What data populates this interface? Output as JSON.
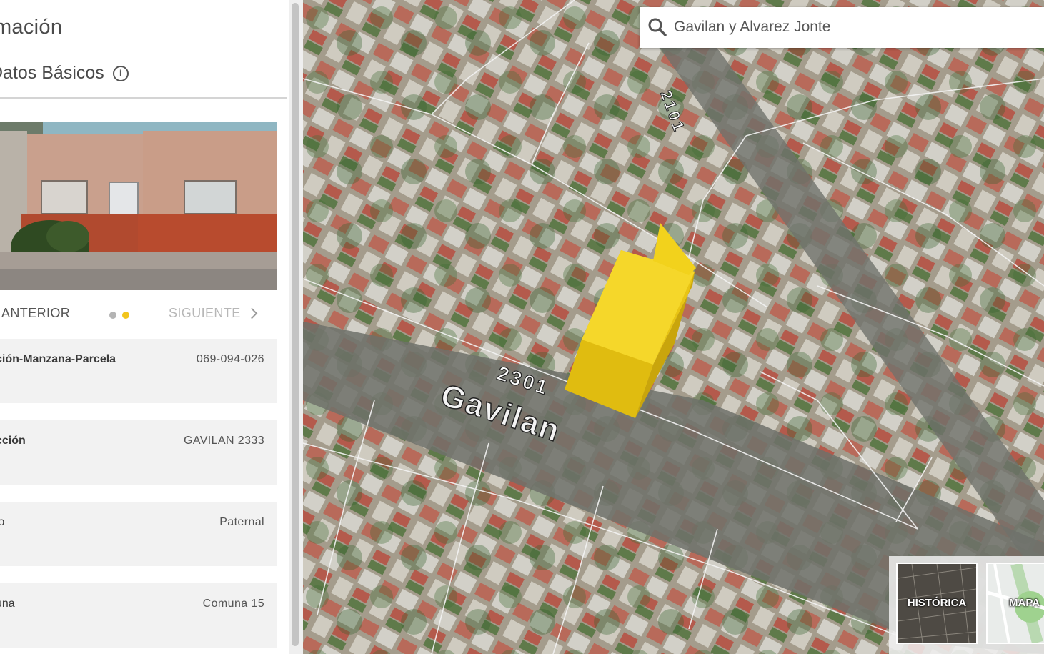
{
  "panel": {
    "title": "rmación",
    "section_header": "Datos Básicos",
    "section_info_icon": "info-icon",
    "carousel": {
      "prev_label": "ANTERIOR",
      "next_label": "SIGUIENTE",
      "pages": 2,
      "active_page": 2
    },
    "rows": [
      {
        "label": "ción-Manzana-Parcela",
        "value": "069-094-026"
      },
      {
        "label": "cción",
        "value": "GAVILAN 2333"
      },
      {
        "label": "io",
        "value": "Paternal"
      },
      {
        "label": "una",
        "value": "Comuna 15"
      }
    ]
  },
  "map": {
    "search": {
      "value": "Gavilan y Alvarez Jonte",
      "icon": "search-icon"
    },
    "street_labels": {
      "street_name": "Gavilan",
      "street_number": "2301",
      "cross_number": "2101"
    },
    "highlight_color": "#f2d21c",
    "basemap_buttons": [
      {
        "label": "HISTÓRICA"
      },
      {
        "label": "MAPA"
      }
    ]
  },
  "colors": {
    "accent": "#f2c51c",
    "row_bg": "#f2f2f2",
    "text_dark": "#4a4a4a"
  }
}
